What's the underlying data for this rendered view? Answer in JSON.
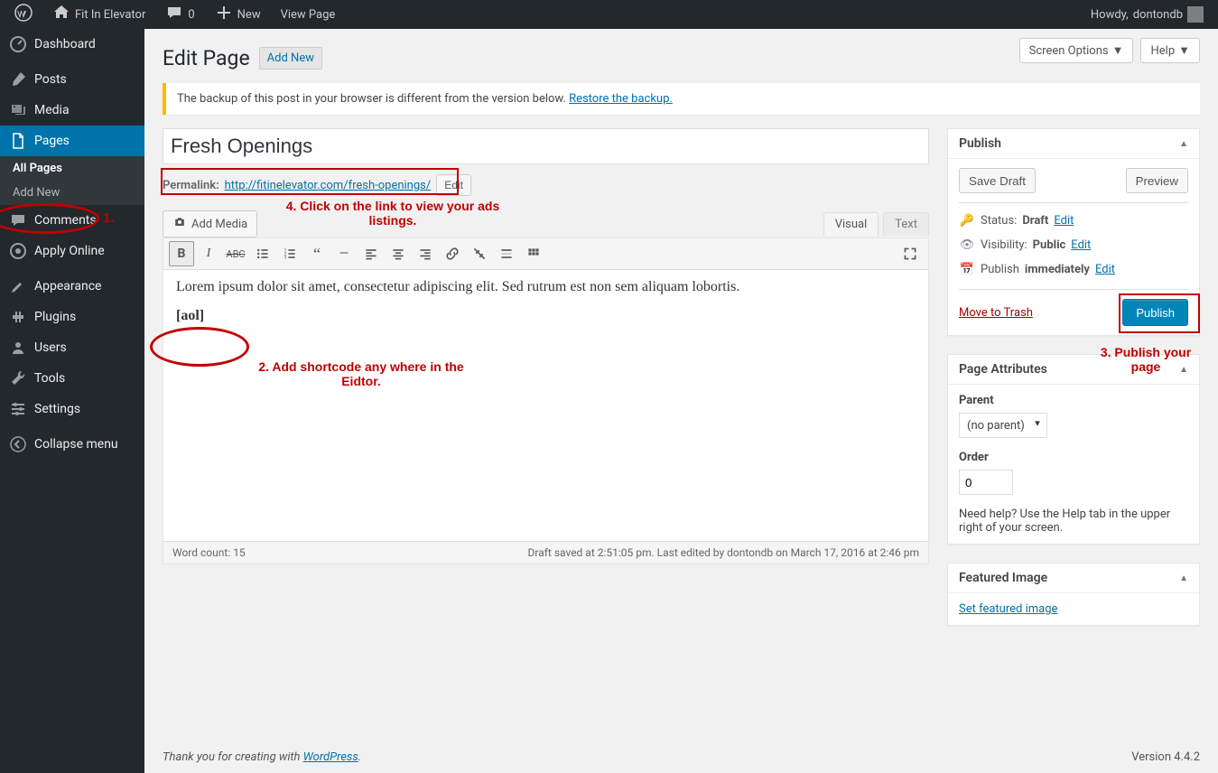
{
  "adminbar": {
    "site_name": "Fit In Elevator",
    "comments_count": "0",
    "new_label": "New",
    "view_page": "View Page",
    "howdy_prefix": "Howdy, ",
    "user_name": "dontondb"
  },
  "sidebar": {
    "items": [
      {
        "label": "Dashboard"
      },
      {
        "label": "Posts"
      },
      {
        "label": "Media"
      },
      {
        "label": "Pages",
        "active": true,
        "subs": [
          {
            "label": "All Pages",
            "current": true
          },
          {
            "label": "Add New"
          }
        ]
      },
      {
        "label": "Comments"
      },
      {
        "label": "Apply Online"
      },
      {
        "label": "Appearance"
      },
      {
        "label": "Plugins"
      },
      {
        "label": "Users"
      },
      {
        "label": "Tools"
      },
      {
        "label": "Settings"
      },
      {
        "label": "Collapse menu"
      }
    ]
  },
  "top_buttons": {
    "screen_options": "Screen Options",
    "help": "Help"
  },
  "heading": "Edit Page",
  "add_new": "Add New",
  "notice": {
    "text": "The backup of this post in your browser is different from the version below. ",
    "link": "Restore the backup."
  },
  "post_title": "Fresh Openings",
  "permalink": {
    "label": "Permalink:",
    "url": "http://fitinelevator.com/fresh-openings/",
    "edit": "Edit"
  },
  "media": {
    "add_media": "Add Media"
  },
  "tabs": {
    "visual": "Visual",
    "text": "Text"
  },
  "content": {
    "p1": "Lorem ipsum dolor sit amet, consectetur adipiscing elit. Sed rutrum est non sem aliquam lobortis.",
    "p2": "[aol]"
  },
  "statusbar": {
    "word_count_label": "Word count: ",
    "word_count": "15",
    "draft_saved": "Draft saved at 2:51:05 pm. Last edited by dontondb on March 17, 2016 at 2:46 pm"
  },
  "publish_box": {
    "title": "Publish",
    "save_draft": "Save Draft",
    "preview": "Preview",
    "status_label": "Status:",
    "status_value": "Draft",
    "visibility_label": "Visibility:",
    "visibility_value": "Public",
    "publish_label": "Publish",
    "publish_value": "immediately",
    "edit": "Edit",
    "trash": "Move to Trash",
    "publish_btn": "Publish"
  },
  "attr_box": {
    "title": "Page Attributes",
    "parent_label": "Parent",
    "parent_value": "(no parent)",
    "order_label": "Order",
    "order_value": "0",
    "help_text": "Need help? Use the Help tab in the upper right of your screen."
  },
  "featured_box": {
    "title": "Featured Image",
    "link": "Set featured image"
  },
  "footer": {
    "thanks_a": "Thank you for creating with ",
    "thanks_b": "WordPress",
    "thanks_c": ".",
    "version": "Version 4.4.2"
  },
  "annotations": {
    "a1": "1.",
    "a2": "2. Add shortcode any where in the Eidtor.",
    "a3": "3. Publish your page",
    "a4": "4. Click on the link to view your ads listings."
  },
  "icons": {
    "wp": "wp",
    "home": "home",
    "comment": "comment",
    "plus": "plus",
    "dashboard": "dashboard",
    "posts": "posts",
    "media": "media",
    "pages": "pages",
    "comments": "comments",
    "apply": "apply",
    "appearance": "appearance",
    "plugins": "plugins",
    "users": "users",
    "tools": "tools",
    "settings": "settings",
    "collapse": "collapse"
  }
}
